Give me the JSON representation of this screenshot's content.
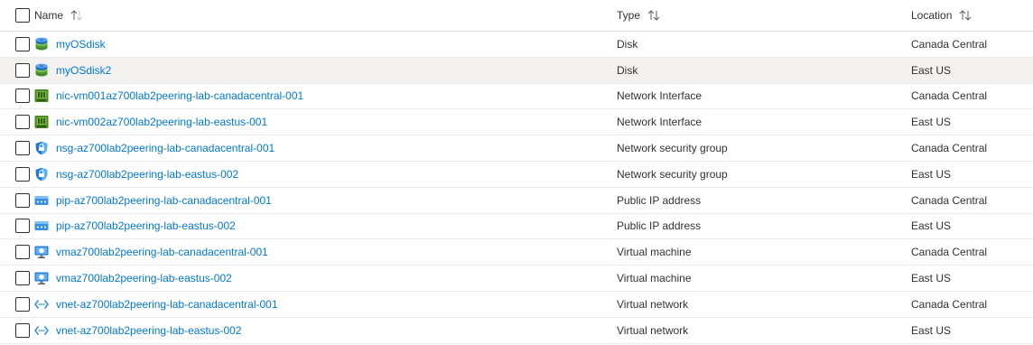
{
  "columns": {
    "name": "Name",
    "type": "Type",
    "location": "Location"
  },
  "rows": [
    {
      "name": "myOSdisk",
      "type": "Disk",
      "location": "Canada Central",
      "icon": "disk-icon"
    },
    {
      "name": "myOSdisk2",
      "type": "Disk",
      "location": "East US",
      "icon": "disk-icon",
      "selected": true
    },
    {
      "name": "nic-vm001az700lab2peering-lab-canadacentral-001",
      "type": "Network Interface",
      "location": "Canada Central",
      "icon": "network-interface-icon"
    },
    {
      "name": "nic-vm002az700lab2peering-lab-eastus-001",
      "type": "Network Interface",
      "location": "East US",
      "icon": "network-interface-icon"
    },
    {
      "name": "nsg-az700lab2peering-lab-canadacentral-001",
      "type": "Network security group",
      "location": "Canada Central",
      "icon": "network-security-group-icon"
    },
    {
      "name": "nsg-az700lab2peering-lab-eastus-002",
      "type": "Network security group",
      "location": "East US",
      "icon": "network-security-group-icon"
    },
    {
      "name": "pip-az700lab2peering-lab-canadacentral-001",
      "type": "Public IP address",
      "location": "Canada Central",
      "icon": "public-ip-icon"
    },
    {
      "name": "pip-az700lab2peering-lab-eastus-002",
      "type": "Public IP address",
      "location": "East US",
      "icon": "public-ip-icon"
    },
    {
      "name": "vmaz700lab2peering-lab-canadacentral-001",
      "type": "Virtual machine",
      "location": "Canada Central",
      "icon": "virtual-machine-icon"
    },
    {
      "name": "vmaz700lab2peering-lab-eastus-002",
      "type": "Virtual machine",
      "location": "East US",
      "icon": "virtual-machine-icon"
    },
    {
      "name": "vnet-az700lab2peering-lab-canadacentral-001",
      "type": "Virtual network",
      "location": "Canada Central",
      "icon": "virtual-network-icon"
    },
    {
      "name": "vnet-az700lab2peering-lab-eastus-002",
      "type": "Virtual network",
      "location": "East US",
      "icon": "virtual-network-icon"
    }
  ],
  "colors": {
    "link": "#0078d4",
    "text": "#323130",
    "selected_row": "#f3f2f1"
  }
}
